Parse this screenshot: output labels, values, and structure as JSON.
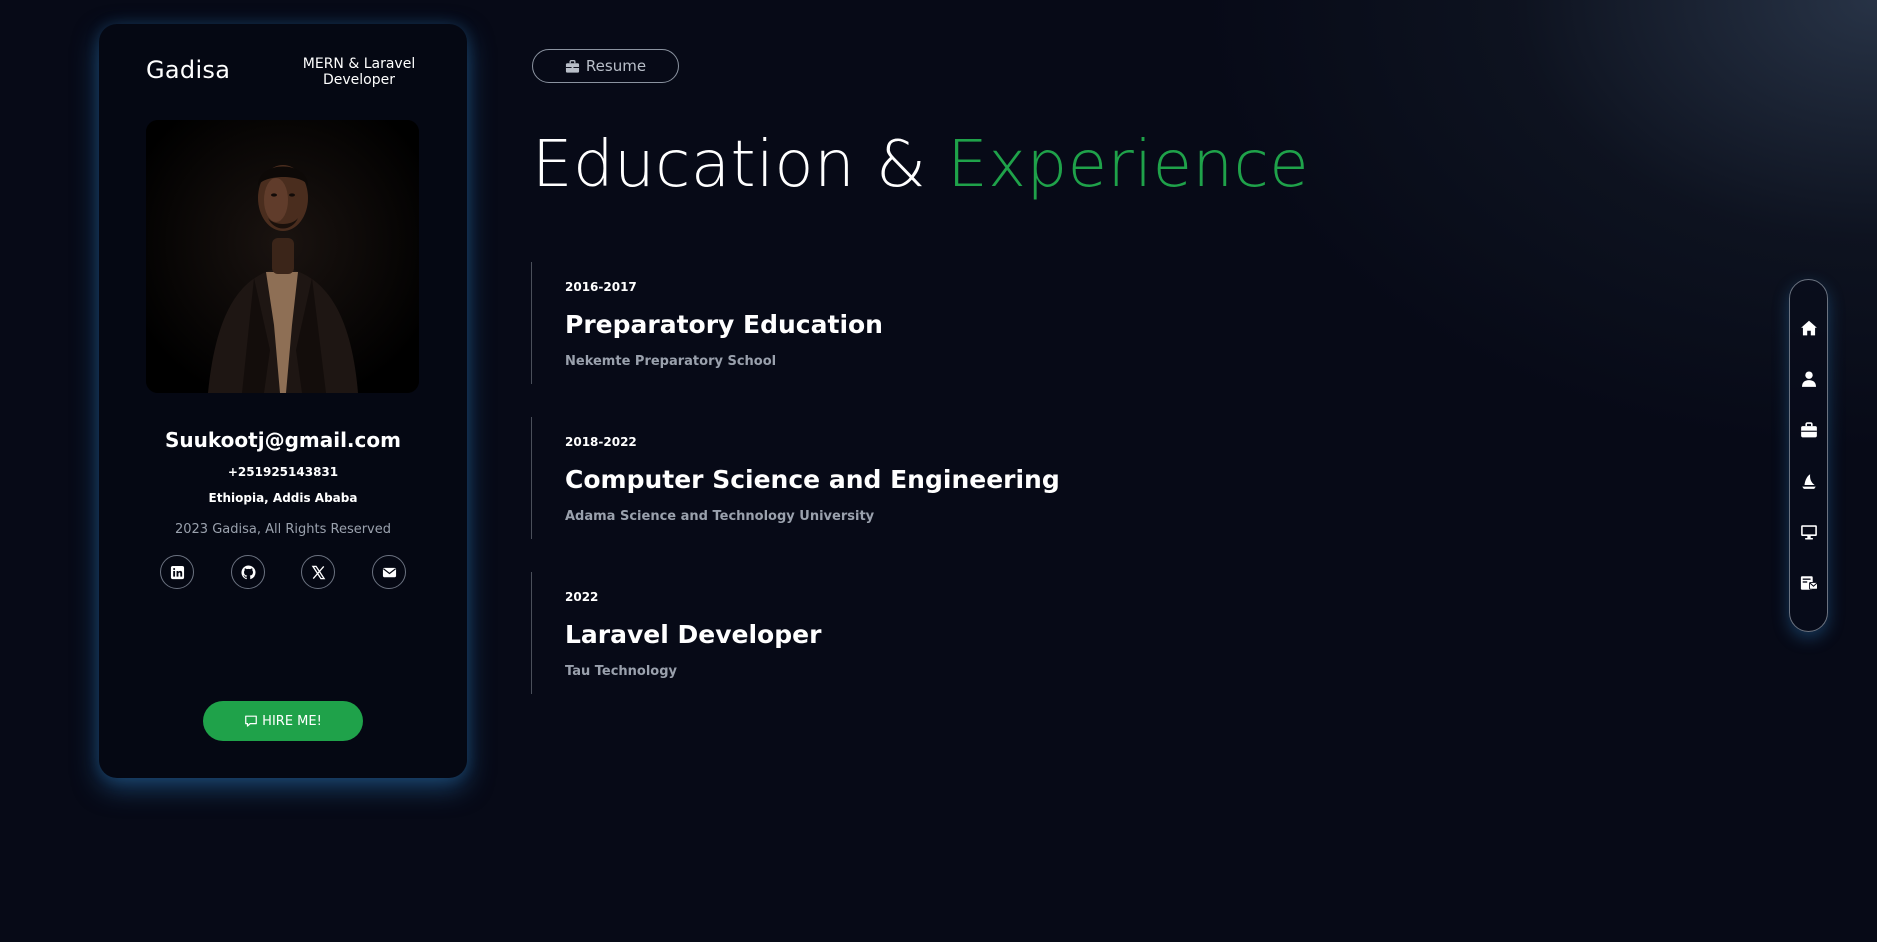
{
  "profile": {
    "name": "Gadisa",
    "role": "MERN & Laravel Developer",
    "email": "Suukootj@gmail.com",
    "phone": "+251925143831",
    "location": "Ethiopia, Addis Ababa",
    "copyright": "2023 Gadisa, All Rights Reserved",
    "socials": [
      {
        "icon": "linkedin-icon"
      },
      {
        "icon": "github-icon"
      },
      {
        "icon": "x-twitter-icon"
      },
      {
        "icon": "envelope-icon"
      }
    ],
    "hire_label": "HIRE ME!"
  },
  "main": {
    "resume_label": "Resume",
    "heading": {
      "plain": "Education &",
      "accent": "Experience"
    },
    "timeline": [
      {
        "date": "2016-2017",
        "title": "Preparatory Education",
        "place": "Nekemte Preparatory School"
      },
      {
        "date": "2018-2022",
        "title": "Computer Science and Engineering",
        "place": "Adama Science and Technology University"
      },
      {
        "date": "2022",
        "title": "Laravel Developer",
        "place": "Tau Technology"
      }
    ]
  },
  "side_nav": {
    "items": [
      {
        "icon": "home-icon"
      },
      {
        "icon": "user-icon"
      },
      {
        "icon": "briefcase-icon"
      },
      {
        "icon": "sailboat-icon"
      },
      {
        "icon": "desktop-icon"
      },
      {
        "icon": "contact-card-icon"
      }
    ]
  },
  "colors": {
    "accent": "#1fa24a",
    "background": "#070a17",
    "card": "#050813",
    "muted_text": "#9aa1ad"
  }
}
